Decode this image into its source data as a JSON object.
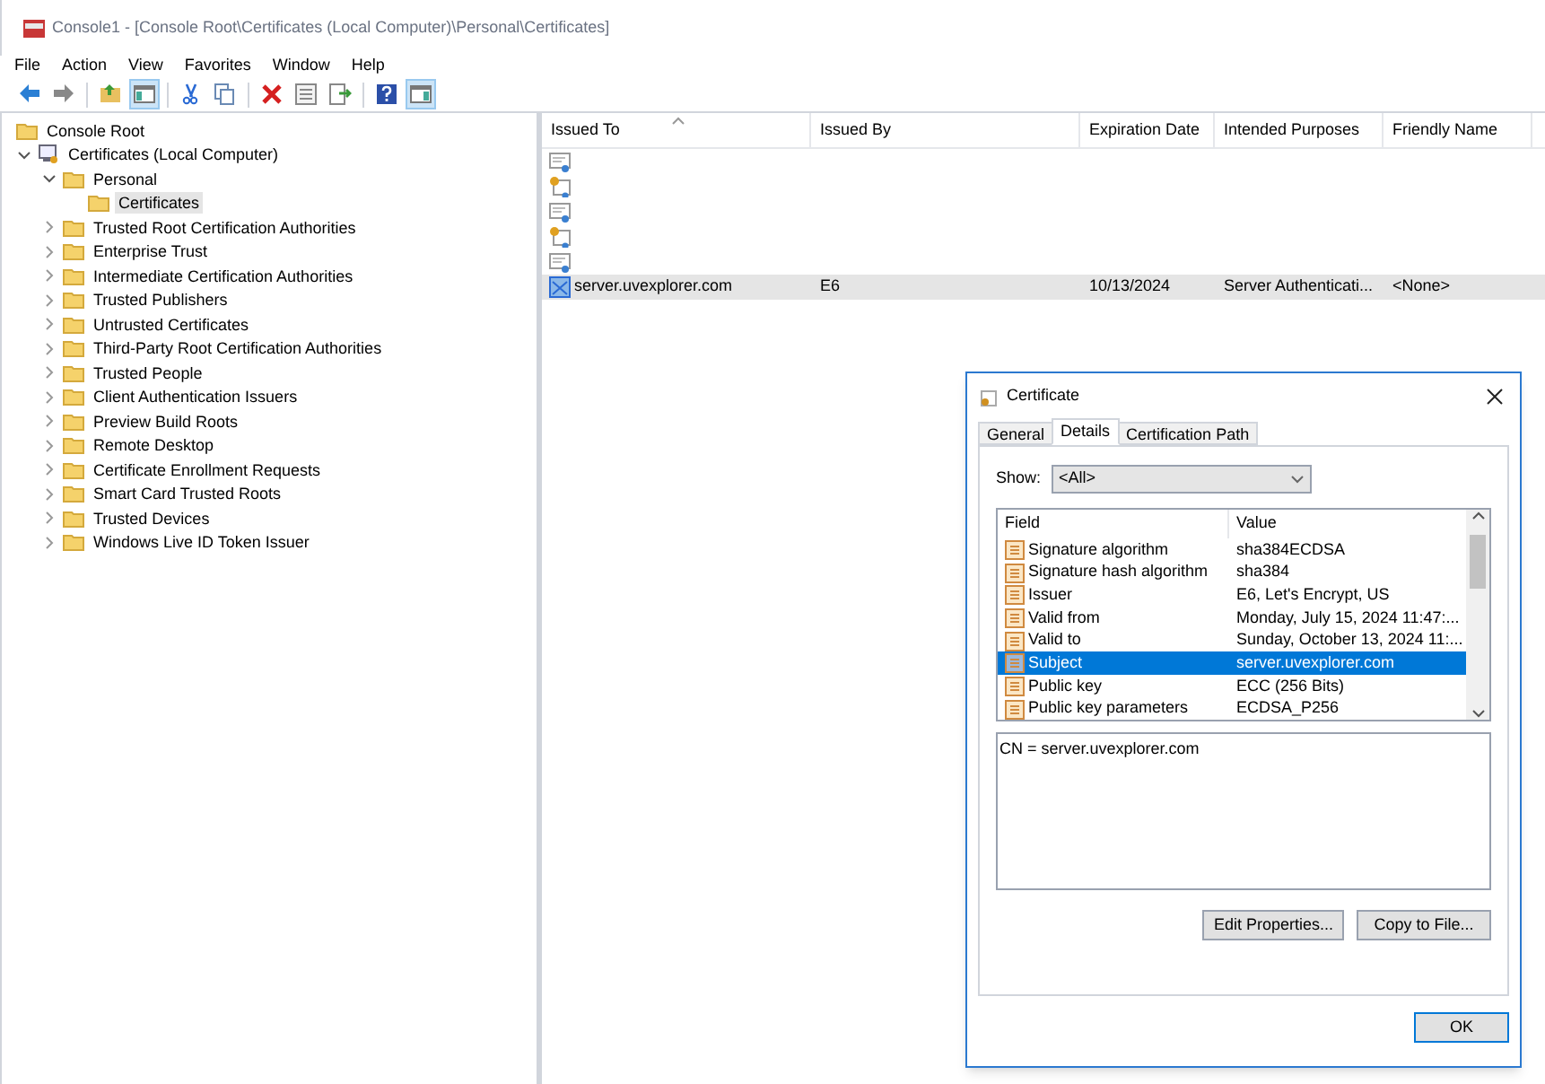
{
  "window": {
    "title": "Console1 - [Console Root\\Certificates (Local Computer)\\Personal\\Certificates]"
  },
  "menu": [
    "File",
    "Action",
    "View",
    "Favorites",
    "Window",
    "Help"
  ],
  "toolbar": [
    {
      "kind": "back",
      "on": false
    },
    {
      "kind": "forward",
      "on": false
    },
    {
      "kind": "sep"
    },
    {
      "kind": "up",
      "on": false
    },
    {
      "kind": "tree",
      "on": true
    },
    {
      "kind": "sep"
    },
    {
      "kind": "cut",
      "on": false
    },
    {
      "kind": "copy",
      "on": false
    },
    {
      "kind": "sep"
    },
    {
      "kind": "delete",
      "on": false
    },
    {
      "kind": "properties",
      "on": false
    },
    {
      "kind": "export",
      "on": false
    },
    {
      "kind": "sep"
    },
    {
      "kind": "help",
      "on": false
    },
    {
      "kind": "actions",
      "on": true
    }
  ],
  "tree": [
    {
      "label": "Console Root",
      "kind": "root",
      "selected": false
    },
    {
      "label": "Certificates (Local Computer)",
      "kind": "store",
      "expanded": true,
      "selected": false,
      "children": [
        {
          "label": "Personal",
          "kind": "folder",
          "expanded": true,
          "selected": false,
          "children": [
            {
              "label": "Certificates",
              "kind": "folder",
              "selected": true
            }
          ]
        },
        {
          "label": "Trusted Root Certification Authorities",
          "kind": "folder",
          "expanded": false,
          "selected": false
        },
        {
          "label": "Enterprise Trust",
          "kind": "folder",
          "expanded": false,
          "selected": false
        },
        {
          "label": "Intermediate Certification Authorities",
          "kind": "folder",
          "expanded": false,
          "selected": false
        },
        {
          "label": "Trusted Publishers",
          "kind": "folder",
          "expanded": false,
          "selected": false
        },
        {
          "label": "Untrusted Certificates",
          "kind": "folder",
          "expanded": false,
          "selected": false
        },
        {
          "label": "Third-Party Root Certification Authorities",
          "kind": "folder",
          "expanded": false,
          "selected": false
        },
        {
          "label": "Trusted People",
          "kind": "folder",
          "expanded": false,
          "selected": false
        },
        {
          "label": "Client Authentication Issuers",
          "kind": "folder",
          "expanded": false,
          "selected": false
        },
        {
          "label": "Preview Build Roots",
          "kind": "folder",
          "expanded": false,
          "selected": false
        },
        {
          "label": "Remote Desktop",
          "kind": "folder",
          "expanded": false,
          "selected": false
        },
        {
          "label": "Certificate Enrollment Requests",
          "kind": "folder",
          "expanded": false,
          "selected": false
        },
        {
          "label": "Smart Card Trusted Roots",
          "kind": "folder",
          "expanded": false,
          "selected": false
        },
        {
          "label": "Trusted Devices",
          "kind": "folder",
          "expanded": false,
          "selected": false
        },
        {
          "label": "Windows Live ID Token Issuer",
          "kind": "folder",
          "expanded": false,
          "selected": false
        }
      ]
    }
  ],
  "table": {
    "columns": [
      "Issued To",
      "Issued By",
      "Expiration Date",
      "Intended Purposes",
      "Friendly Name"
    ],
    "rows": [
      {
        "kind": "cert",
        "selected": false
      },
      {
        "kind": "cert_key",
        "selected": false
      },
      {
        "kind": "cert",
        "selected": false
      },
      {
        "kind": "cert_key",
        "selected": false
      },
      {
        "kind": "cert",
        "selected": false
      },
      {
        "kind": "cert_blue",
        "selected": true,
        "cells": [
          "server.uvexplorer.com",
          "E6",
          "10/13/2024",
          "Server Authenticati...",
          "<None>"
        ]
      }
    ]
  },
  "dialog": {
    "title": "Certificate",
    "tabs": [
      {
        "label": "General",
        "selected": false
      },
      {
        "label": "Details",
        "selected": true
      },
      {
        "label": "Certification Path",
        "selected": false
      }
    ],
    "show_label": "Show:",
    "show_value": "<All>",
    "columns": [
      "Field",
      "Value"
    ],
    "fields": [
      {
        "field": "Signature algorithm",
        "value": "sha384ECDSA",
        "selected": false
      },
      {
        "field": "Signature hash algorithm",
        "value": "sha384",
        "selected": false
      },
      {
        "field": "Issuer",
        "value": "E6, Let's Encrypt, US",
        "selected": false
      },
      {
        "field": "Valid from",
        "value": "Monday, July 15, 2024 11:47:...",
        "selected": false
      },
      {
        "field": "Valid to",
        "value": "Sunday, October 13, 2024 11:...",
        "selected": false
      },
      {
        "field": "Subject",
        "value": "server.uvexplorer.com",
        "selected": true
      },
      {
        "field": "Public key",
        "value": "ECC (256 Bits)",
        "selected": false
      },
      {
        "field": "Public key parameters",
        "value": "ECDSA_P256",
        "selected": false
      }
    ],
    "detail": "CN = server.uvexplorer.com",
    "buttons": [
      "Edit Properties...",
      "Copy to File..."
    ],
    "ok": "OK"
  }
}
